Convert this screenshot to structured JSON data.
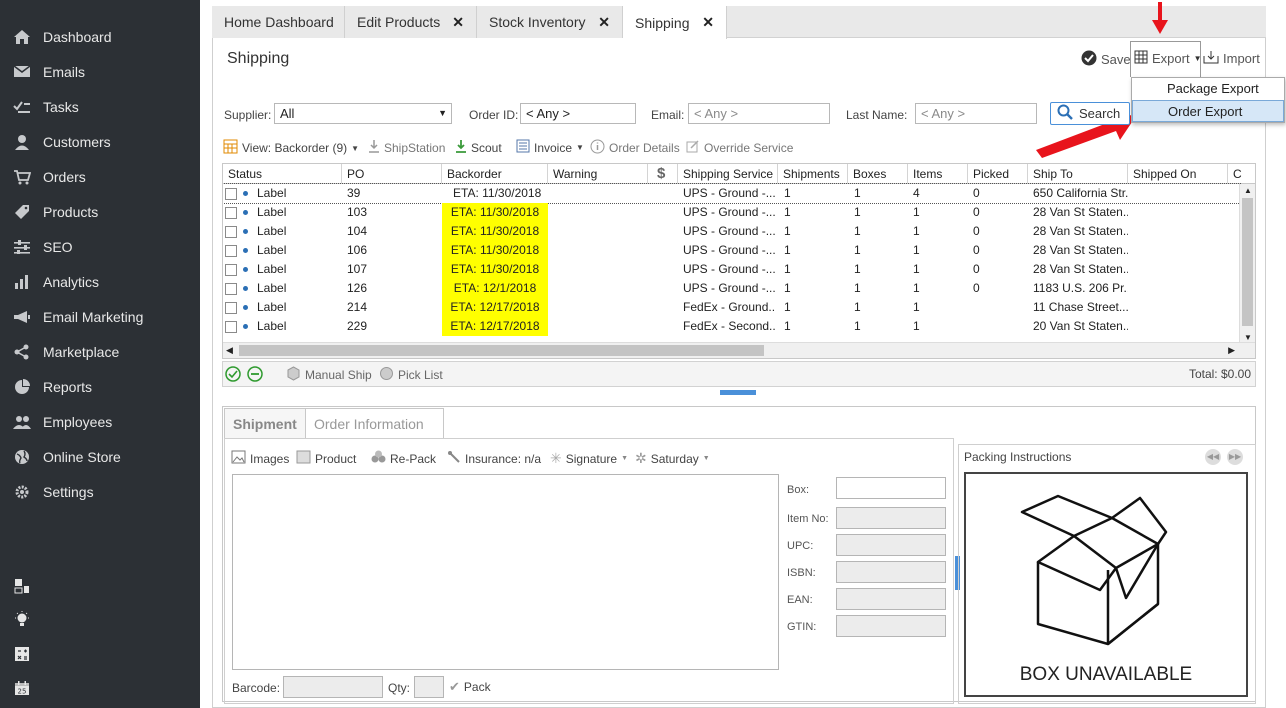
{
  "sidebar": {
    "items": [
      {
        "label": "Dashboard",
        "icon": "home-icon"
      },
      {
        "label": "Emails",
        "icon": "envelope-icon"
      },
      {
        "label": "Tasks",
        "icon": "tasks-icon"
      },
      {
        "label": "Customers",
        "icon": "user-icon"
      },
      {
        "label": "Orders",
        "icon": "cart-icon"
      },
      {
        "label": "Products",
        "icon": "tag-icon"
      },
      {
        "label": "SEO",
        "icon": "sliders-icon"
      },
      {
        "label": "Analytics",
        "icon": "bar-chart-icon"
      },
      {
        "label": "Email Marketing",
        "icon": "megaphone-icon"
      },
      {
        "label": "Marketplace",
        "icon": "share-icon"
      },
      {
        "label": "Reports",
        "icon": "pie-chart-icon"
      },
      {
        "label": "Employees",
        "icon": "users-icon"
      },
      {
        "label": "Online Store",
        "icon": "globe-icon"
      },
      {
        "label": "Settings",
        "icon": "gear-icon"
      }
    ]
  },
  "tabs": [
    {
      "label": "Home Dashboard",
      "closable": false
    },
    {
      "label": "Edit Products",
      "closable": true
    },
    {
      "label": "Stock Inventory",
      "closable": true
    },
    {
      "label": "Shipping",
      "closable": true,
      "active": true
    }
  ],
  "header": {
    "title": "Shipping",
    "save_label": "Save",
    "export_label": "Export",
    "import_label": "Import"
  },
  "export_menu": {
    "items": [
      "Package Export",
      "Order Export"
    ],
    "highlighted": "Order Export"
  },
  "filters": {
    "supplier_label": "Supplier:",
    "supplier_value": "All",
    "order_id_label": "Order ID:",
    "order_id_value": "< Any >",
    "email_label": "Email:",
    "email_placeholder": "< Any >",
    "last_name_label": "Last Name:",
    "last_name_placeholder": "< Any >",
    "search_label": "Search"
  },
  "toolbar": {
    "view_label": "View: Backorder (9)",
    "shipstation": "ShipStation",
    "scout": "Scout",
    "invoice": "Invoice",
    "order_details": "Order Details",
    "override_service": "Override Service"
  },
  "grid": {
    "columns": [
      "Status",
      "PO",
      "Backorder",
      "Warning",
      "$",
      "Shipping Service",
      "Shipments",
      "Boxes",
      "Items",
      "Picked",
      "Ship To",
      "Shipped On",
      "C"
    ],
    "rows": [
      {
        "status": "Label",
        "po": "39",
        "backorder": "ETA: 11/30/2018",
        "hl": false,
        "service": "UPS - Ground -...",
        "shipments": "1",
        "boxes": "1",
        "items": "4",
        "picked": "0",
        "ship_to": "650 California Str..."
      },
      {
        "status": "Label",
        "po": "103",
        "backorder": "ETA: 11/30/2018",
        "hl": true,
        "service": "UPS - Ground -...",
        "shipments": "1",
        "boxes": "1",
        "items": "1",
        "picked": "0",
        "ship_to": "28 Van St Staten..."
      },
      {
        "status": "Label",
        "po": "104",
        "backorder": "ETA: 11/30/2018",
        "hl": true,
        "service": "UPS - Ground -...",
        "shipments": "1",
        "boxes": "1",
        "items": "1",
        "picked": "0",
        "ship_to": "28 Van St Staten..."
      },
      {
        "status": "Label",
        "po": "106",
        "backorder": "ETA: 11/30/2018",
        "hl": true,
        "service": "UPS - Ground -...",
        "shipments": "1",
        "boxes": "1",
        "items": "1",
        "picked": "0",
        "ship_to": "28 Van St Staten..."
      },
      {
        "status": "Label",
        "po": "107",
        "backorder": "ETA: 11/30/2018",
        "hl": true,
        "service": "UPS - Ground -...",
        "shipments": "1",
        "boxes": "1",
        "items": "1",
        "picked": "0",
        "ship_to": "28 Van St Staten..."
      },
      {
        "status": "Label",
        "po": "126",
        "backorder": "ETA: 12/1/2018",
        "hl": true,
        "service": "UPS - Ground -...",
        "shipments": "1",
        "boxes": "1",
        "items": "1",
        "picked": "0",
        "ship_to": "1183 U.S. 206 Pr..."
      },
      {
        "status": "Label",
        "po": "214",
        "backorder": "ETA: 12/17/2018",
        "hl": true,
        "service": "FedEx - Ground...",
        "shipments": "1",
        "boxes": "1",
        "items": "1",
        "picked": "",
        "ship_to": "11 Chase Street..."
      },
      {
        "status": "Label",
        "po": "229",
        "backorder": "ETA: 12/17/2018",
        "hl": true,
        "service": "FedEx - Second...",
        "shipments": "1",
        "boxes": "1",
        "items": "1",
        "picked": "",
        "ship_to": "20 Van St Staten..."
      }
    ]
  },
  "bottom": {
    "manual_ship": "Manual Ship",
    "pick_list": "Pick List",
    "total": "Total: $0.00"
  },
  "lower": {
    "tab_shipment": "Shipment",
    "tab_order_info": "Order Information",
    "images": "Images",
    "product": "Product",
    "repack": "Re-Pack",
    "insurance": "Insurance: n/a",
    "signature": "Signature",
    "saturday": "Saturday",
    "box_label": "Box:",
    "item_no_label": "Item No:",
    "upc_label": "UPC:",
    "isbn_label": "ISBN:",
    "ean_label": "EAN:",
    "gtin_label": "GTIN:",
    "barcode_label": "Barcode:",
    "qty_label": "Qty:",
    "pack_label": "Pack",
    "packing_title": "Packing Instructions",
    "box_unavailable": "BOX UNAVAILABLE"
  },
  "colors": {
    "sidebar_bg": "#2c3035",
    "highlight_yellow": "#ffff00",
    "arrow_red": "#e8141c"
  }
}
